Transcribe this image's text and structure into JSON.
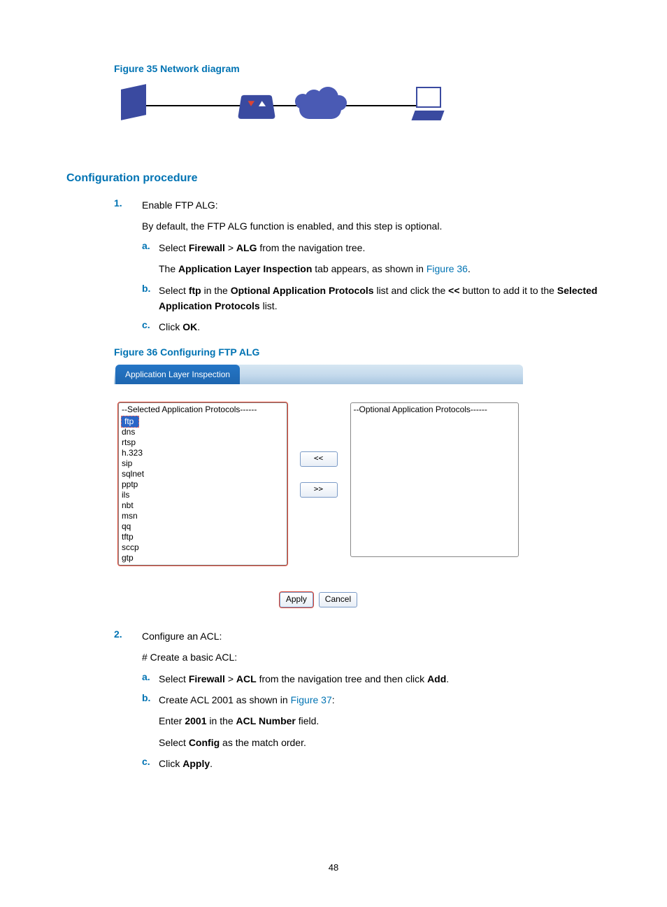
{
  "figure35_caption": "Figure 35 Network diagram",
  "section_heading": "Configuration procedure",
  "step1": {
    "marker": "1.",
    "title": "Enable FTP ALG:",
    "default_note": "By default, the FTP ALG function is enabled, and this step is optional.",
    "a": {
      "marker": "a.",
      "line1_pre": "Select ",
      "firewall": "Firewall",
      "gt": " > ",
      "alg": "ALG",
      "line1_post": " from the navigation tree.",
      "line2_pre": "The ",
      "ali": "Application Layer Inspection",
      "line2_mid": " tab appears, as shown in ",
      "fig36_link": "Figure 36",
      "line2_end": "."
    },
    "b": {
      "marker": "b.",
      "pre": "Select ",
      "ftp": "ftp",
      "mid1": " in the ",
      "oap": "Optional Application Protocols",
      "mid2": " list and click the ",
      "lt": "<<",
      "mid3": " button to add it to the ",
      "sap": "Selected Application Protocols",
      "end": " list."
    },
    "c": {
      "marker": "c.",
      "pre": "Click ",
      "ok": "OK",
      "end": "."
    }
  },
  "figure36_caption": "Figure 36 Configuring FTP ALG",
  "screenshot": {
    "tab": "Application Layer Inspection",
    "selected_header": "--Selected Application Protocols------",
    "optional_header": "--Optional Application Protocols------",
    "selected_items": [
      "ftp",
      "dns",
      "rtsp",
      "h.323",
      "sip",
      "sqlnet",
      "pptp",
      "ils",
      "nbt",
      "msn",
      "qq",
      "tftp",
      "sccp",
      "gtp"
    ],
    "optional_items": [],
    "move_left": "<<",
    "move_right": ">>",
    "apply": "Apply",
    "cancel": "Cancel"
  },
  "step2": {
    "marker": "2.",
    "title": "Configure an ACL:",
    "create_note": "# Create a basic ACL:",
    "a": {
      "marker": "a.",
      "pre": "Select ",
      "firewall": "Firewall",
      "gt": " > ",
      "acl": "ACL",
      "mid": " from the navigation tree and then click ",
      "add": "Add",
      "end": "."
    },
    "b": {
      "marker": "b.",
      "pre": "Create ACL 2001 as shown in ",
      "fig37_link": "Figure 37",
      "end": ":",
      "enter_pre": "Enter ",
      "v2001": "2001",
      "enter_mid": " in the ",
      "aclnum": "ACL Number",
      "enter_end": " field.",
      "select_pre": "Select ",
      "config": "Config",
      "select_end": " as the match order."
    },
    "c": {
      "marker": "c.",
      "pre": "Click ",
      "apply": "Apply",
      "end": "."
    }
  },
  "page_number": "48"
}
